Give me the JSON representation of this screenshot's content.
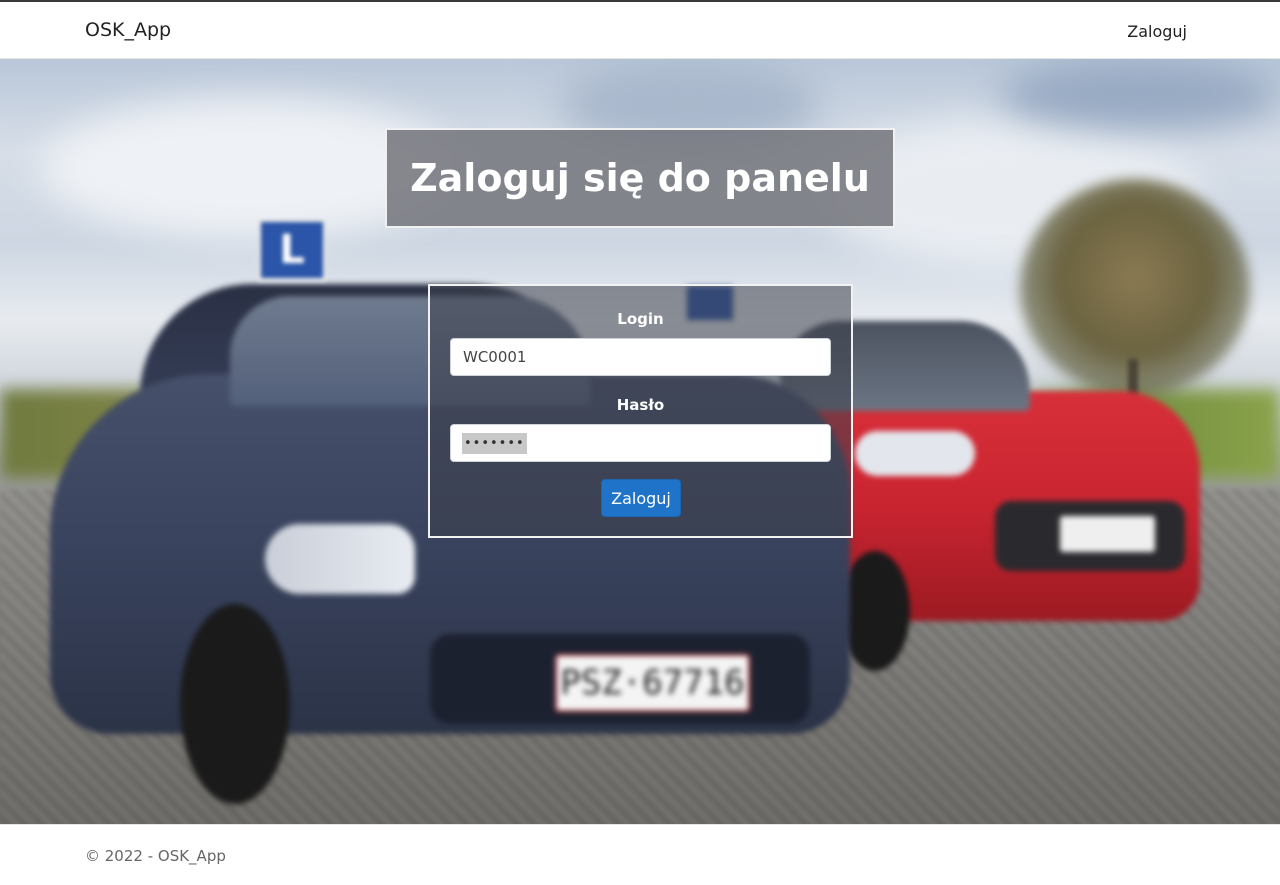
{
  "navbar": {
    "brand": "OSK_App",
    "login_link": "Zaloguj"
  },
  "hero": {
    "background": "blurred photo of two driving-school cars",
    "plate_text": "PSZ·67716",
    "sign_letter": "L"
  },
  "login": {
    "title": "Zaloguj się do panelu",
    "login_label": "Login",
    "login_value": "WC0001",
    "password_label": "Hasło",
    "password_mask": "•••••••",
    "submit_label": "Zaloguj"
  },
  "footer": {
    "text": "© 2022 - OSK_App"
  },
  "colors": {
    "accent": "#1f73c9",
    "title_box": "#76787e",
    "text": "#222222"
  }
}
